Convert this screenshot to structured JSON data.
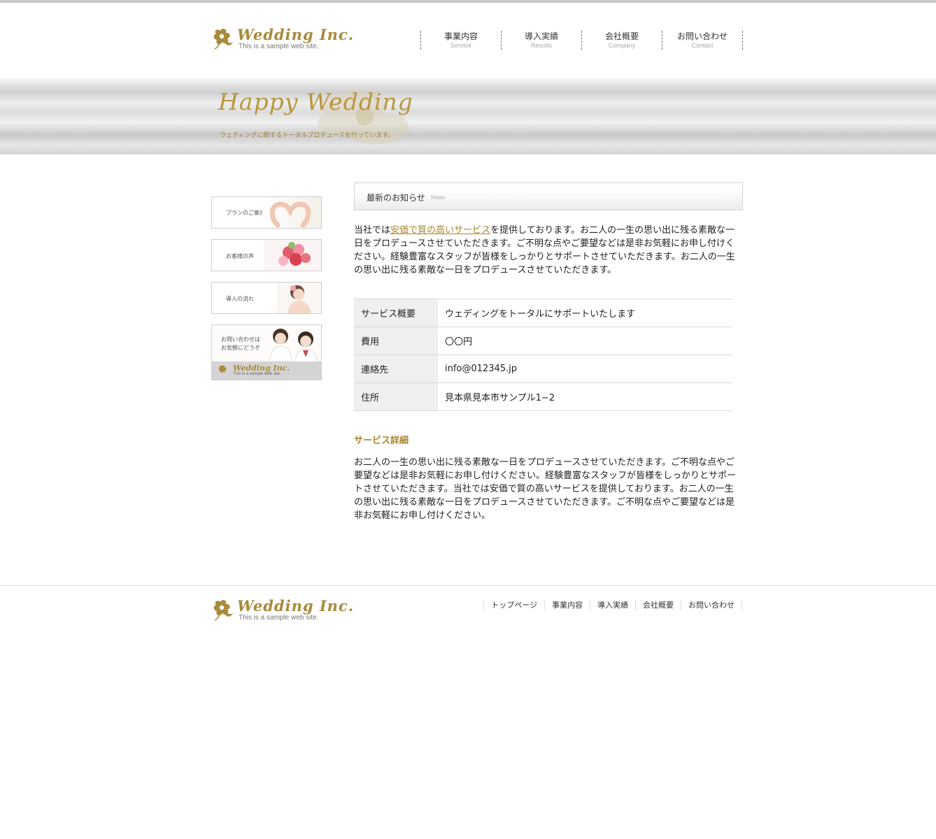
{
  "logo": {
    "name": "Wedding Inc.",
    "tagline": "This is a sample web site."
  },
  "nav": [
    {
      "jp": "事業内容",
      "en": "Service"
    },
    {
      "jp": "導入実績",
      "en": "Results"
    },
    {
      "jp": "会社概要",
      "en": "Company"
    },
    {
      "jp": "お問い合わせ",
      "en": "Contact"
    }
  ],
  "hero": {
    "title": "Happy Wedding",
    "subtitle": "ウェディングに関するトータルプロデュースを行っています。"
  },
  "sidebar": {
    "plan": "プランのご案内",
    "voice": "お客様の声",
    "flow": "導入の流れ",
    "contact_line1": "お問い合わせは",
    "contact_line2": "お気軽にどうぞ",
    "contact_logo": "Wedding Inc.",
    "contact_tagline": "This is a sample web site."
  },
  "news": {
    "title": "最新のお知らせ",
    "en": "News"
  },
  "intro": {
    "before": "当社では",
    "link": "安価で質の高いサービス",
    "after": "を提供しております。お二人の一生の思い出に残る素敵な一日をプロデュースさせていただきます。ご不明な点やご要望などは是非お気軽にお申し付けください。経験豊富なスタッフが皆様をしっかりとサポートさせていただきます。お二人の一生の思い出に残る素敵な一日をプロデュースさせていただきます。"
  },
  "table": [
    {
      "key": "サービス概要",
      "value": "ウェディングをトータルにサポートいたします"
    },
    {
      "key": "費用",
      "value": "〇〇円"
    },
    {
      "key": "連絡先",
      "value": "info@012345.jp"
    },
    {
      "key": "住所",
      "value": "見本県見本市サンプル1−2"
    }
  ],
  "detail": {
    "heading": "サービス詳細",
    "text": "お二人の一生の思い出に残る素敵な一日をプロデュースさせていただきます。ご不明な点やご要望などは是非お気軽にお申し付けください。経験豊富なスタッフが皆様をしっかりとサポートさせていただきます。当社では安価で質の高いサービスを提供しております。お二人の一生の思い出に残る素敵な一日をプロデュースさせていただきます。ご不明な点やご要望などは是非お気軽にお申し付けください。"
  },
  "footer_nav": [
    "トップページ",
    "事業内容",
    "導入実績",
    "会社概要",
    "お問い合わせ"
  ],
  "colors": {
    "gold": "#a8852c",
    "gray_bar": "#c8c8c8"
  }
}
